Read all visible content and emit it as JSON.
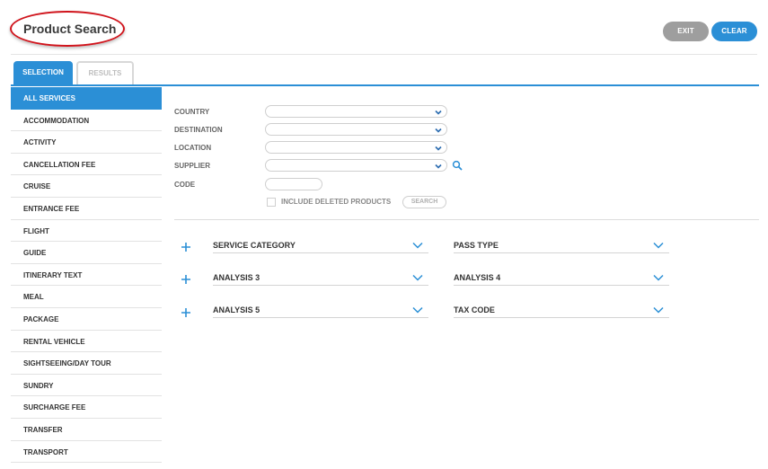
{
  "header": {
    "title": "Product Search",
    "exit_label": "EXIT",
    "clear_label": "CLEAR"
  },
  "tabs": {
    "selection": "SELECTION",
    "results": "RESULTS"
  },
  "sidebar": {
    "items": [
      "ALL SERVICES",
      "ACCOMMODATION",
      "ACTIVITY",
      "CANCELLATION FEE",
      "CRUISE",
      "ENTRANCE FEE",
      "FLIGHT",
      "GUIDE",
      "ITINERARY TEXT",
      "MEAL",
      "PACKAGE",
      "RENTAL VEHICLE",
      "SIGHTSEEING/DAY TOUR",
      "SUNDRY",
      "SURCHARGE FEE",
      "TRANSFER",
      "TRANSPORT"
    ]
  },
  "form": {
    "country_label": "COUNTRY",
    "destination_label": "DESTINATION",
    "location_label": "LOCATION",
    "supplier_label": "SUPPLIER",
    "code_label": "CODE",
    "include_deleted_label": "INCLUDE DELETED PRODUCTS",
    "search_label": "SEARCH"
  },
  "filters": {
    "service_category": "SERVICE CATEGORY",
    "pass_type": "PASS TYPE",
    "analysis_3": "ANALYSIS 3",
    "analysis_4": "ANALYSIS 4",
    "analysis_5": "ANALYSIS 5",
    "tax_code": "TAX CODE"
  },
  "colors": {
    "accent": "#2b8fd6",
    "title_oval": "#d0141c",
    "exit_button": "#9e9e9e"
  }
}
